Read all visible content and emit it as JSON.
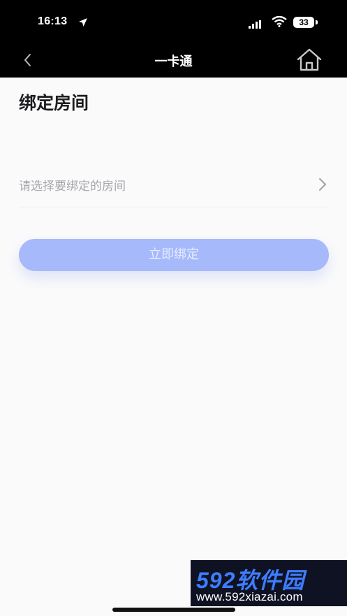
{
  "status_bar": {
    "time": "16:13",
    "battery": "33"
  },
  "nav": {
    "title": "一卡通"
  },
  "page": {
    "title": "绑定房间"
  },
  "room_select": {
    "placeholder": "请选择要绑定的房间"
  },
  "bind_button": {
    "label": "立即绑定"
  },
  "watermark": {
    "brand": "592软件园",
    "url": "www.592xiazai.com"
  },
  "colors": {
    "button": "#a6b9fb",
    "header_bg": "#000000",
    "placeholder": "#a5a5ab"
  }
}
